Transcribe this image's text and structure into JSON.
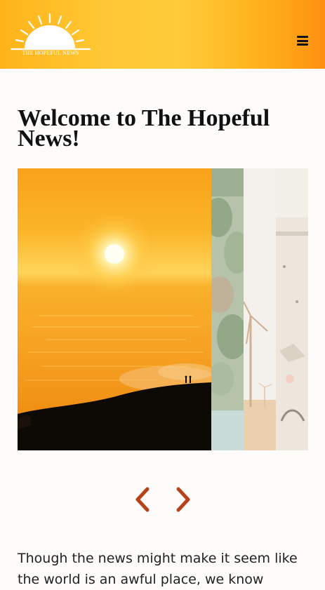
{
  "header": {
    "logo_text": "THE HOPEFUL NEWS",
    "menu_icon": "hamburger-icon",
    "colors": {
      "gradient_start": "#ffb319",
      "gradient_mid": "#ffcb3a",
      "gradient_end": "#ff8f10"
    }
  },
  "main": {
    "title": "Welcome to The Hopeful News!",
    "carousel": {
      "slides": [
        "sunset-over-hill-photo",
        "forest-photo",
        "wind-turbine-photo",
        "beach-cleanup-photo"
      ],
      "prev_icon": "chevron-left-icon",
      "next_icon": "chevron-right-icon",
      "arrow_color": "#b8431a"
    },
    "intro_text": "Though the news might make it seem like the world is an awful place, we know"
  }
}
